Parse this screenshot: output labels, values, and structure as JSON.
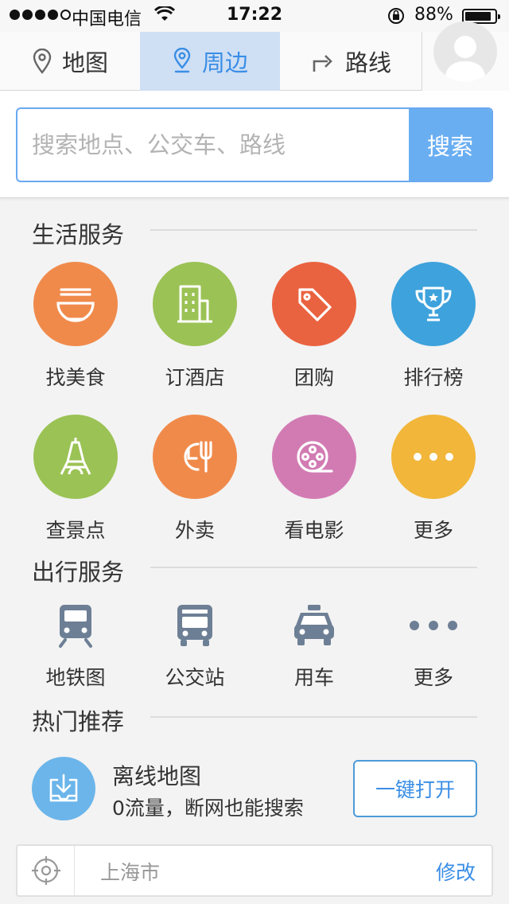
{
  "status_bar": {
    "carrier": "中国电信",
    "time": "17:22",
    "battery": "88%",
    "battery_level": 0.88
  },
  "tabs": [
    {
      "label": "地图",
      "icon": "map-pin-icon",
      "active": false
    },
    {
      "label": "周边",
      "icon": "location-pin-icon",
      "active": true
    },
    {
      "label": "路线",
      "icon": "route-turn-icon",
      "active": false
    }
  ],
  "search": {
    "placeholder": "搜索地点、公交车、路线",
    "button": "搜索"
  },
  "life_services": {
    "title": "生活服务",
    "items": [
      {
        "label": "找美食",
        "icon": "noodle-bowl-icon",
        "color": "#f08a4b"
      },
      {
        "label": "订酒店",
        "icon": "hotel-building-icon",
        "color": "#9bc255"
      },
      {
        "label": "团购",
        "icon": "tag-icon",
        "color": "#ea6340"
      },
      {
        "label": "排行榜",
        "icon": "trophy-icon",
        "color": "#3ea2dc"
      },
      {
        "label": "查景点",
        "icon": "tower-icon",
        "color": "#9bc255"
      },
      {
        "label": "外卖",
        "icon": "clock-fork-icon",
        "color": "#f08a4b"
      },
      {
        "label": "看电影",
        "icon": "film-reel-icon",
        "color": "#d27bb3"
      },
      {
        "label": "更多",
        "icon": "more-dots-icon",
        "color": "#f1b63a"
      }
    ]
  },
  "travel_services": {
    "title": "出行服务",
    "items": [
      {
        "label": "地铁图",
        "icon": "subway-icon"
      },
      {
        "label": "公交站",
        "icon": "bus-icon"
      },
      {
        "label": "用车",
        "icon": "taxi-icon"
      },
      {
        "label": "更多",
        "icon": "more-dots-icon"
      }
    ]
  },
  "recommend": {
    "title": "热门推荐",
    "offline": {
      "title": "离线地图",
      "subtitle": "0流量，断网也能搜索",
      "button": "一键打开",
      "icon": "download-map-icon"
    }
  },
  "city_bar": {
    "city": "上海市",
    "edit": "修改",
    "icon": "locate-icon"
  },
  "colors": {
    "accent": "#3a8ee6",
    "search_button": "#6aaef2",
    "travel_icon": "#6d7f95"
  }
}
